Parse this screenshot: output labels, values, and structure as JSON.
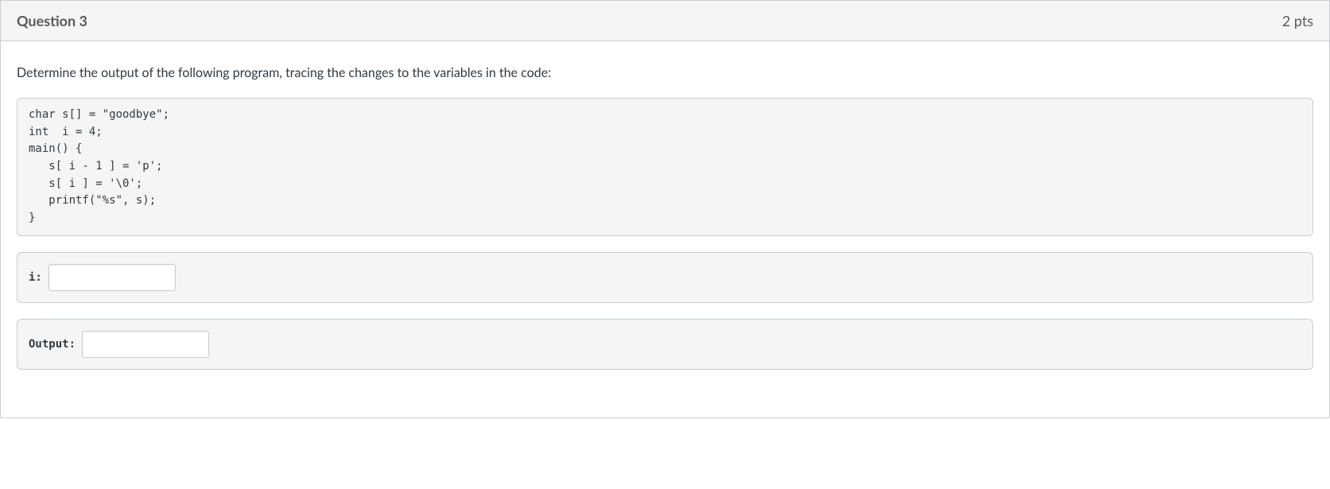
{
  "header": {
    "title": "Question 3",
    "points": "2 pts"
  },
  "body": {
    "prompt": "Determine the output of the following program, tracing the changes to the variables in the code:",
    "code": "char s[] = \"goodbye\";\nint  i = 4;\nmain() {\n   s[ i - 1 ] = 'p';\n   s[ i ] = '\\0';\n   printf(\"%s\", s);\n}",
    "answers": [
      {
        "label": "i:",
        "value": ""
      },
      {
        "label": "Output:",
        "value": ""
      }
    ]
  }
}
